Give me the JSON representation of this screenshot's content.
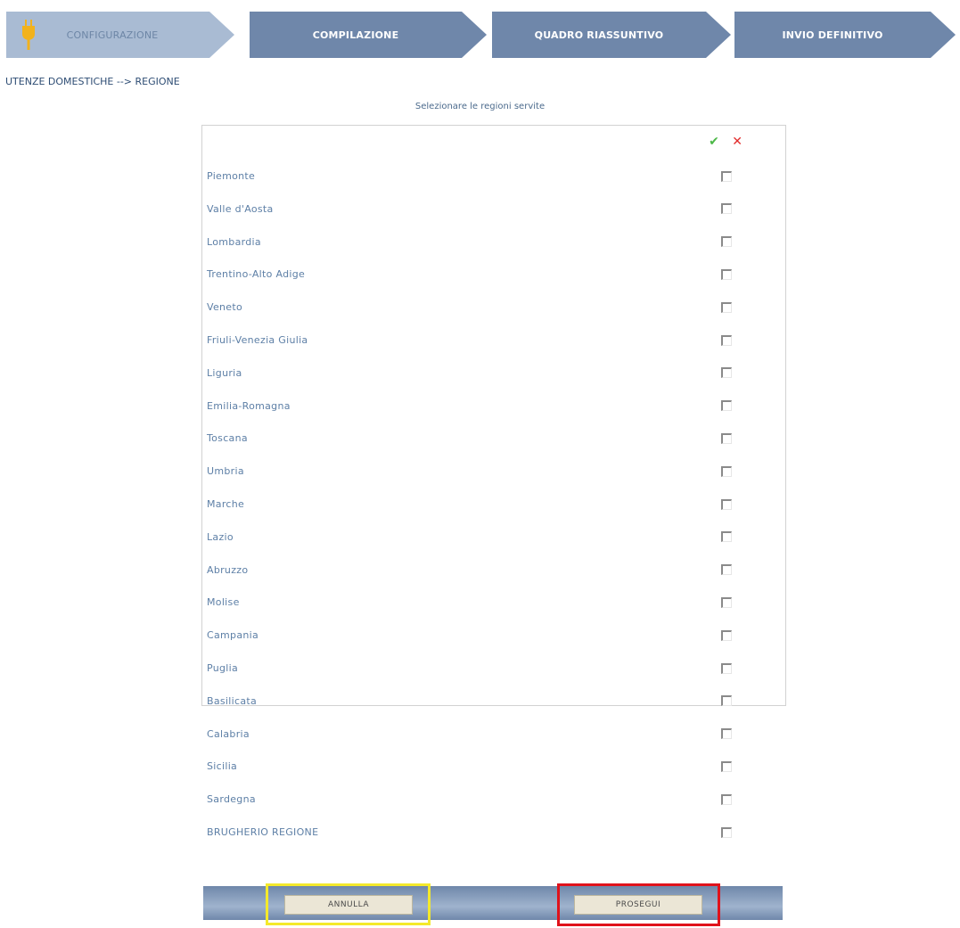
{
  "wizard": {
    "steps": [
      {
        "label": "CONFIGURAZIONE",
        "icon": "plug-icon"
      },
      {
        "label": "COMPILAZIONE"
      },
      {
        "label": "QUADRO RIASSUNTIVO"
      },
      {
        "label": "INVIO DEFINITIVO"
      }
    ],
    "colors": {
      "active": "#a9bbd3",
      "inactive": "#6f87aa",
      "plug": "#f2b21c"
    }
  },
  "breadcrumb": "UTENZE DOMESTICHE --> REGIONE",
  "subtitle": "Selezionare le regioni servite",
  "header_icons": {
    "check_all": "✔",
    "uncheck_all": "✕"
  },
  "regions": [
    {
      "name": "Piemonte",
      "checked": false
    },
    {
      "name": "Valle d'Aosta",
      "checked": false
    },
    {
      "name": "Lombardia",
      "checked": false
    },
    {
      "name": "Trentino-Alto Adige",
      "checked": false
    },
    {
      "name": "Veneto",
      "checked": false
    },
    {
      "name": "Friuli-Venezia Giulia",
      "checked": false
    },
    {
      "name": "Liguria",
      "checked": false
    },
    {
      "name": "Emilia-Romagna",
      "checked": false
    },
    {
      "name": "Toscana",
      "checked": false
    },
    {
      "name": "Umbria",
      "checked": false
    },
    {
      "name": "Marche",
      "checked": false
    },
    {
      "name": "Lazio",
      "checked": false
    },
    {
      "name": "Abruzzo",
      "checked": false
    },
    {
      "name": "Molise",
      "checked": false
    },
    {
      "name": "Campania",
      "checked": false
    },
    {
      "name": "Puglia",
      "checked": false
    },
    {
      "name": "Basilicata",
      "checked": false
    },
    {
      "name": "Calabria",
      "checked": false
    },
    {
      "name": "Sicilia",
      "checked": false
    },
    {
      "name": "Sardegna",
      "checked": false
    },
    {
      "name": "BRUGHERIO REGIONE",
      "checked": false
    }
  ],
  "buttons": {
    "cancel": "ANNULLA",
    "proceed": "PROSEGUI"
  },
  "highlights": {
    "cancel": "#f4e92b",
    "proceed": "#e0121b"
  }
}
